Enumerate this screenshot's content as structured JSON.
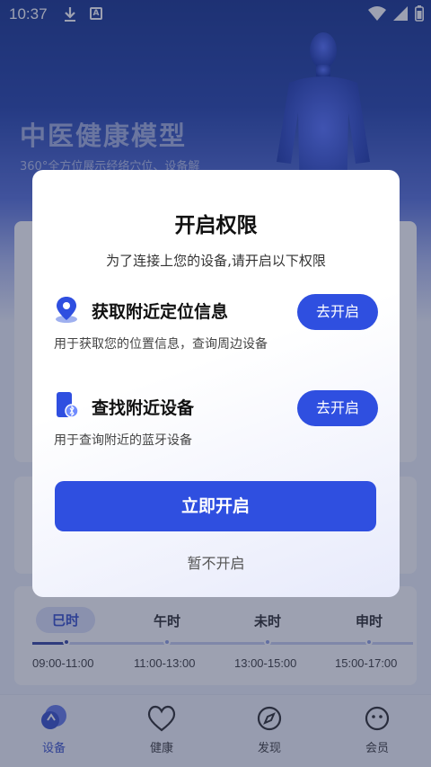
{
  "status_bar": {
    "time": "10:37"
  },
  "hero": {
    "title": "中医健康模型",
    "subtitle": "360°全方位展示经络穴位、设备解"
  },
  "timeline": {
    "items": [
      {
        "label": "巳时",
        "time": "09:00-11:00",
        "active": true
      },
      {
        "label": "午时",
        "time": "11:00-13:00",
        "active": false
      },
      {
        "label": "未时",
        "time": "13:00-15:00",
        "active": false
      },
      {
        "label": "申时",
        "time": "15:00-17:00",
        "active": false
      }
    ]
  },
  "tabs": [
    {
      "label": "设备",
      "icon": "device-icon",
      "active": true
    },
    {
      "label": "健康",
      "icon": "heart-icon",
      "active": false
    },
    {
      "label": "发现",
      "icon": "compass-icon",
      "active": false
    },
    {
      "label": "会员",
      "icon": "member-face-icon",
      "active": false
    }
  ],
  "dialog": {
    "title": "开启权限",
    "subtitle": "为了连接上您的设备,请开启以下权限",
    "permissions": [
      {
        "name": "获取附近定位信息",
        "description": "用于获取您的位置信息，查询周边设备",
        "button": "去开启",
        "icon": "location-pin-icon"
      },
      {
        "name": "查找附近设备",
        "description": "用于查询附近的蓝牙设备",
        "button": "去开启",
        "icon": "bluetooth-phone-icon"
      }
    ],
    "primary_button": "立即开启",
    "secondary_button": "暂不开启"
  },
  "colors": {
    "accent": "#2f4fe0",
    "overlay": "rgba(50,58,92,0.48)"
  }
}
